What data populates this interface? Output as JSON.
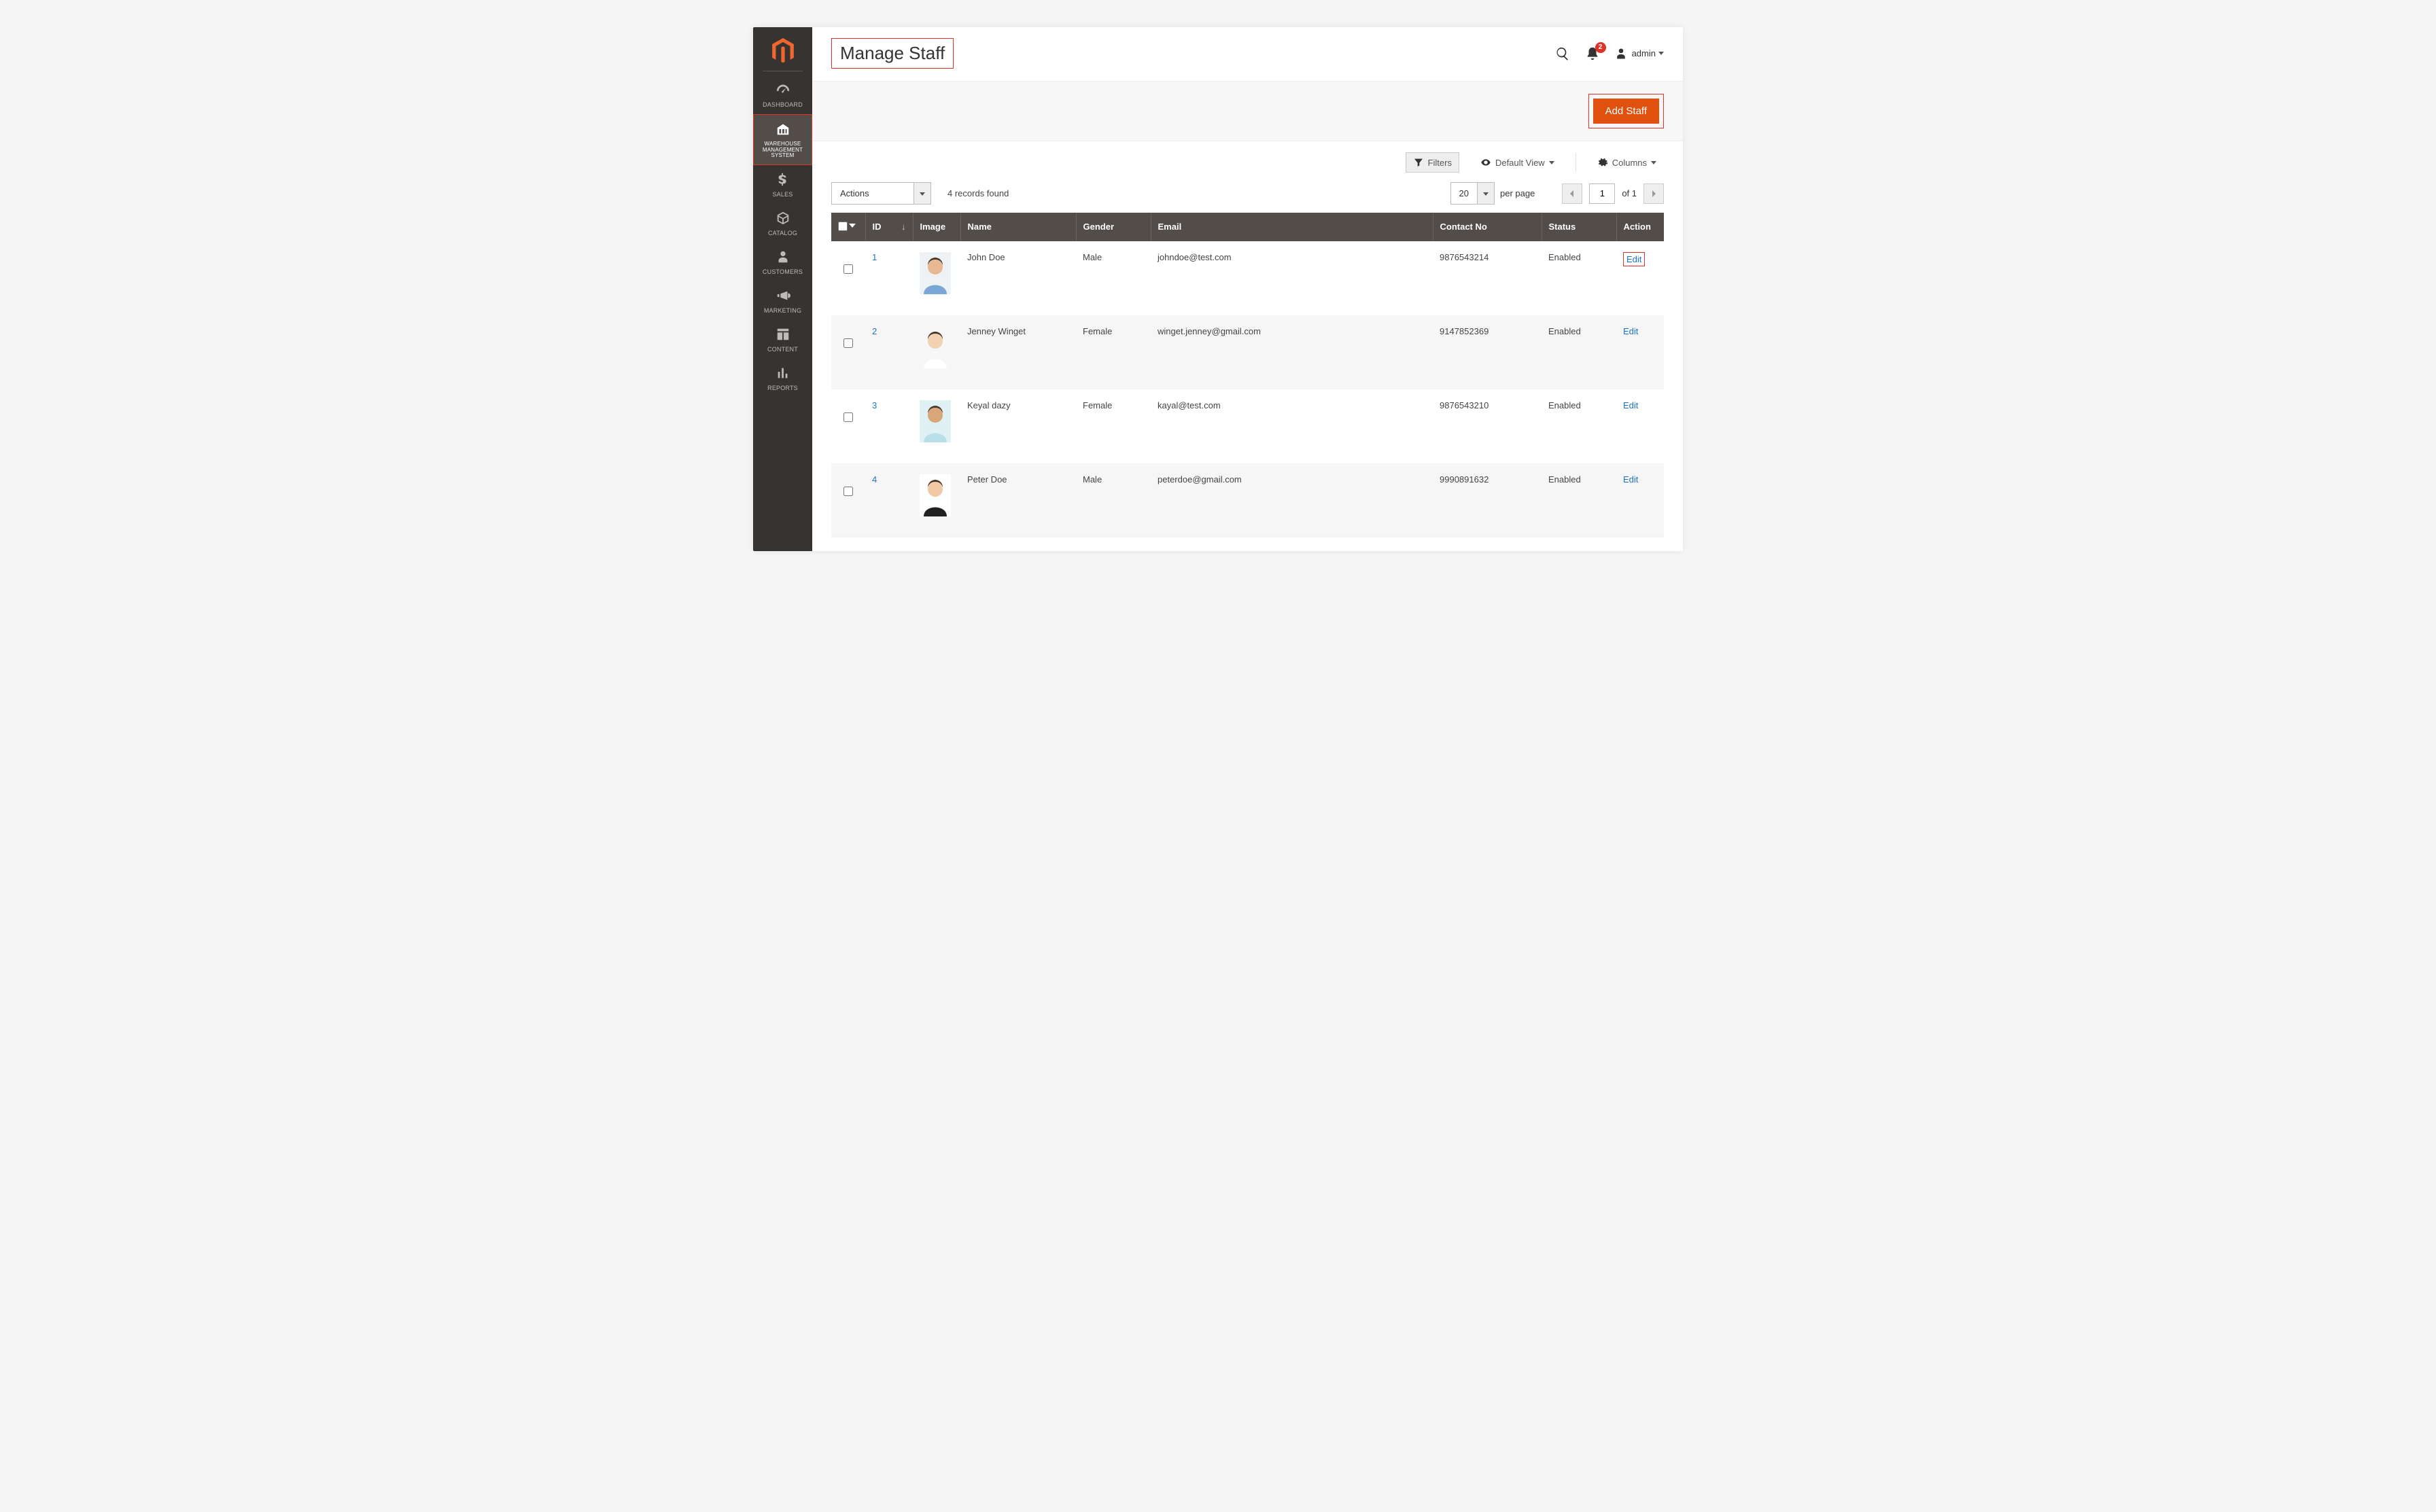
{
  "sidebar": {
    "items": [
      {
        "label": "DASHBOARD"
      },
      {
        "label": "WAREHOUSE MANAGEMENT SYSTEM"
      },
      {
        "label": "SALES"
      },
      {
        "label": "CATALOG"
      },
      {
        "label": "CUSTOMERS"
      },
      {
        "label": "MARKETING"
      },
      {
        "label": "CONTENT"
      },
      {
        "label": "REPORTS"
      }
    ]
  },
  "header": {
    "title": "Manage Staff",
    "notifications_count": "2",
    "username": "admin"
  },
  "actions": {
    "add_staff": "Add Staff"
  },
  "toolbar": {
    "filters": "Filters",
    "default_view": "Default View",
    "columns": "Columns"
  },
  "grid": {
    "actions_label": "Actions",
    "records_found": "4 records found",
    "per_page_value": "20",
    "per_page_label": "per page",
    "page_current": "1",
    "page_of_label": "of 1",
    "columns": {
      "id": "ID",
      "image": "Image",
      "name": "Name",
      "gender": "Gender",
      "email": "Email",
      "contact": "Contact No",
      "status": "Status",
      "action": "Action"
    },
    "rows": [
      {
        "id": "1",
        "name": "John Doe",
        "gender": "Male",
        "email": "johndoe@test.com",
        "contact": "9876543214",
        "status": "Enabled",
        "action": "Edit"
      },
      {
        "id": "2",
        "name": "Jenney Winget",
        "gender": "Female",
        "email": "winget.jenney@gmail.com",
        "contact": "9147852369",
        "status": "Enabled",
        "action": "Edit"
      },
      {
        "id": "3",
        "name": "Keyal dazy",
        "gender": "Female",
        "email": "kayal@test.com",
        "contact": "9876543210",
        "status": "Enabled",
        "action": "Edit"
      },
      {
        "id": "4",
        "name": "Peter Doe",
        "gender": "Male",
        "email": "peterdoe@gmail.com",
        "contact": "9990891632",
        "status": "Enabled",
        "action": "Edit"
      }
    ]
  },
  "avatars": {
    "skin": [
      "#e8b894",
      "#f3d2b3",
      "#d9a679",
      "#f0c9a6"
    ],
    "shirt": [
      "#7aa7d4",
      "#ffffff",
      "#b9e0ea",
      "#222222"
    ],
    "bg": [
      "#eef2f5",
      "#f7f7f7",
      "#dff1f5",
      "#ffffff"
    ]
  }
}
